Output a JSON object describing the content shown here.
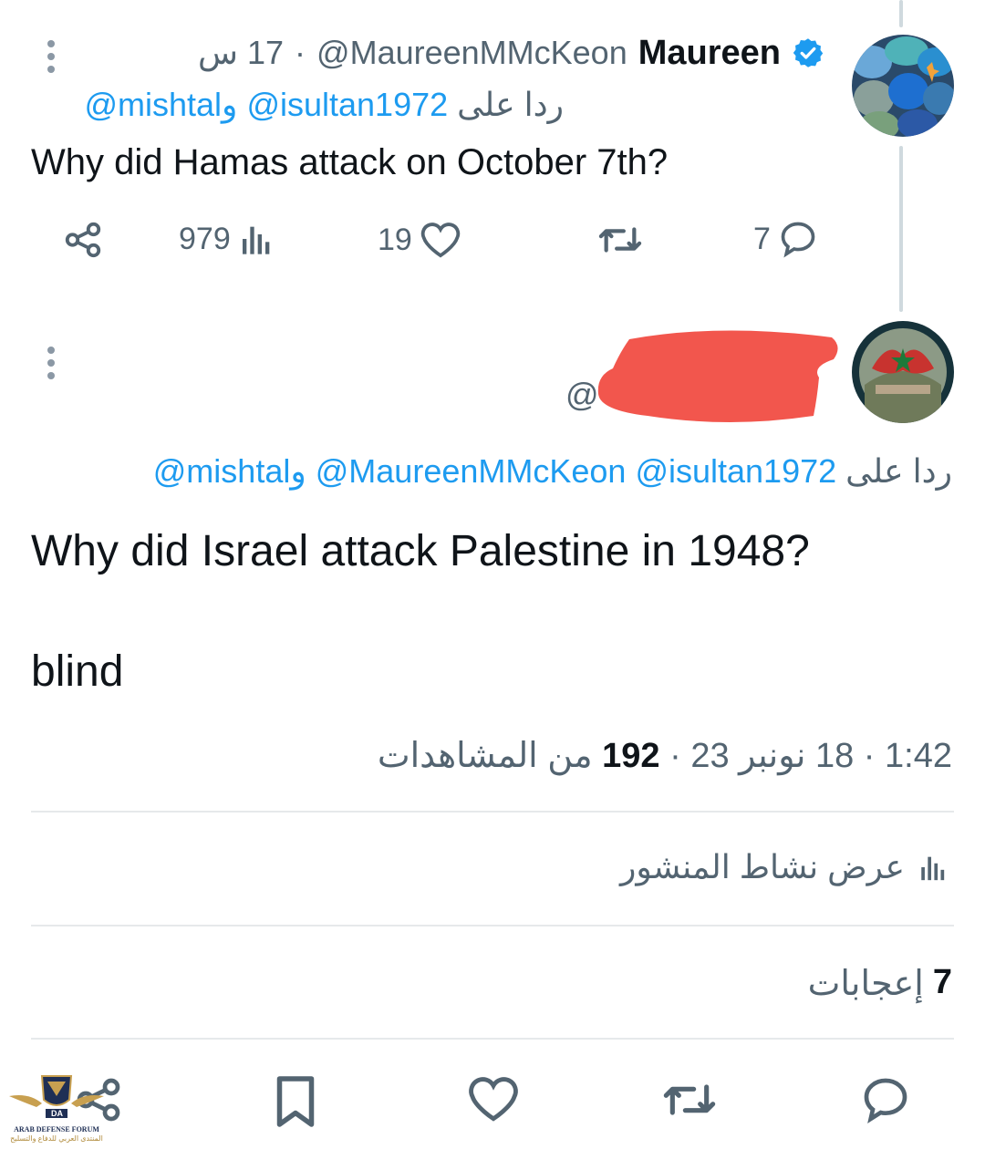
{
  "tweet1": {
    "display_name": "Maureen",
    "handle": "@MaureenMMcKeon",
    "time": "17 س",
    "reply_prefix": "ردا على",
    "reply_handles": [
      "@isultan1972",
      "@mishtal"
    ],
    "reply_joiner": "و",
    "text": "Why did Hamas attack on October 7th?",
    "views": "979",
    "likes": "19",
    "replies": "7",
    "verified": true
  },
  "tweet2": {
    "handle_visible": "@",
    "reply_prefix": "ردا على",
    "reply_handles": [
      "@isultan1972",
      "@MaureenMMcKeon",
      "@mishtal"
    ],
    "reply_joiner": "و",
    "text": "Why did Israel attack Palestine in 1948?\n\nblind",
    "time": "1:42",
    "date": "18 نونبر 23",
    "views_count": "192",
    "views_label": "من المشاهدات",
    "activity_label": "عرض نشاط المنشور",
    "likes_count": "7",
    "likes_label": "إعجابات"
  },
  "watermark": {
    "line1": "ARAB DEFENSE FORUM",
    "line2": "المنتدى العربي للدفاع والتسليح",
    "logo": "DA"
  },
  "colors": {
    "link": "#1d9bf0",
    "secondary": "#536471",
    "redaction": "#f2564d",
    "verified": "#1d9bf0"
  },
  "icons": [
    "more-icon",
    "verified-icon",
    "share-icon",
    "views-icon",
    "like-icon",
    "retweet-icon",
    "reply-icon",
    "bookmark-icon"
  ]
}
